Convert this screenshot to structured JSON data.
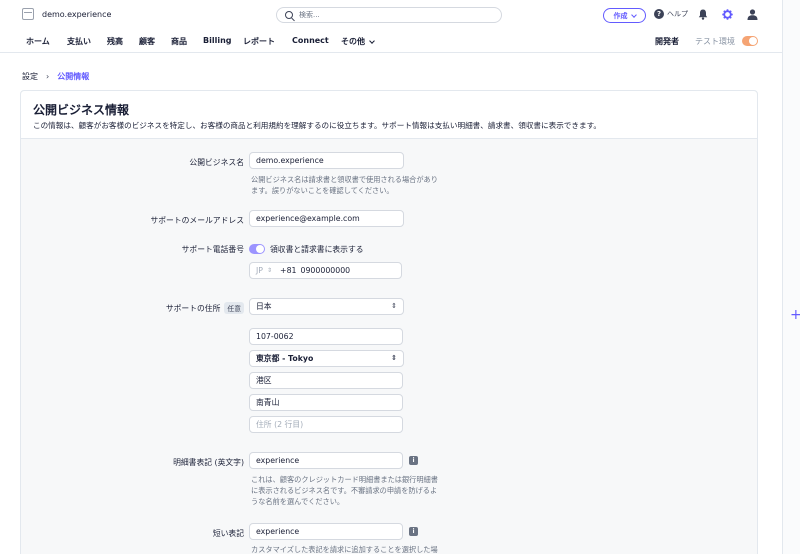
{
  "account": {
    "name": "demo.experience"
  },
  "search": {
    "placeholder": "検索..."
  },
  "topbar": {
    "create_label": "作成",
    "help_label": "ヘルプ"
  },
  "nav": {
    "items": [
      "ホーム",
      "支払い",
      "残高",
      "顧客",
      "商品",
      "Billing",
      "レポート",
      "Connect",
      "その他"
    ],
    "developer_label": "開発者",
    "test_mode_label": "テスト環境"
  },
  "breadcrumb": {
    "parent": "設定",
    "current": "公開情報"
  },
  "card": {
    "title": "公開ビジネス情報",
    "description": "この情報は、顧客がお客様のビジネスを特定し、お客様の商品と利用規約を理解するのに役立ちます。サポート情報は支払い明細書、請求書、領収書に表示できます。"
  },
  "form": {
    "business_name": {
      "label": "公開ビジネス名",
      "value": "demo.experience",
      "hint_line1": "公開ビジネス名は請求書と領収書で使用される場合があり",
      "hint_line2": "ます。誤りがないことを確認してください。"
    },
    "support_email": {
      "label": "サポートのメールアドレス",
      "value": "experience@example.com"
    },
    "support_phone": {
      "label": "サポート電話番号",
      "toggle_label": "領収書と請求書に表示する",
      "country_code": "JP",
      "dial_code": "+81",
      "number": "0900000000"
    },
    "support_address": {
      "label": "サポートの住所",
      "optional": "任意",
      "country": "日本",
      "postal_code": "107-0062",
      "prefecture": "東京都 - Tokyo",
      "city": "港区",
      "line1": "南青山",
      "line2_placeholder": "住所 (2 行目)"
    },
    "statement_descriptor": {
      "label": "明細書表記 (英文字)",
      "value": "experience",
      "hint_line1": "これは、顧客のクレジットカード明細書または銀行明細書",
      "hint_line2": "に表示されるビジネス名です。不審請求の申請を防げるよ",
      "hint_line3": "うな名前を選んでください。"
    },
    "short_descriptor": {
      "label": "短い表記",
      "value": "experience",
      "hint_line1": "カスタマイズした表記を請求に追加することを選択した場"
    }
  },
  "colors": {
    "accent": "#635bff",
    "test_toggle": "#f5a474"
  }
}
